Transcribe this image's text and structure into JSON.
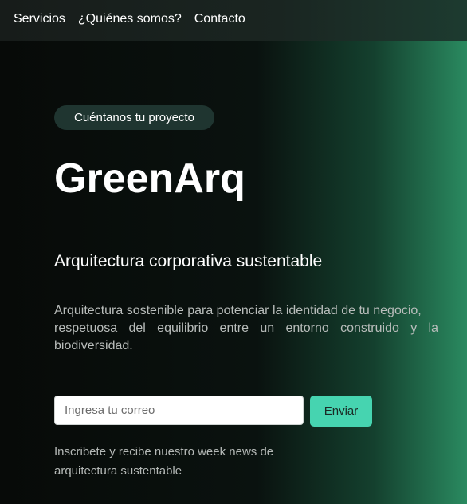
{
  "nav": {
    "items": [
      {
        "label": "Servicios"
      },
      {
        "label": "¿Quiénes somos?"
      },
      {
        "label": "Contacto"
      }
    ]
  },
  "hero": {
    "cta_pill": "Cuéntanos tu proyecto",
    "brand": "GreenArq",
    "subtitle": "Arquitectura corporativa sustentable",
    "description_line1": "Arquitectura sostenible para potenciar la identidad de tu negocio,",
    "description_line2": "respetuosa del equilibrio entre un entorno construido y la biodiversidad."
  },
  "newsletter": {
    "email_placeholder": "Ingresa tu correo",
    "email_value": "",
    "send_label": "Enviar",
    "note": "Inscribete y recibe nuestro week news de arquitectura sustentable"
  },
  "colors": {
    "accent": "#46d4b0",
    "gradient_end": "#2a8a60",
    "background": "#070a08"
  }
}
